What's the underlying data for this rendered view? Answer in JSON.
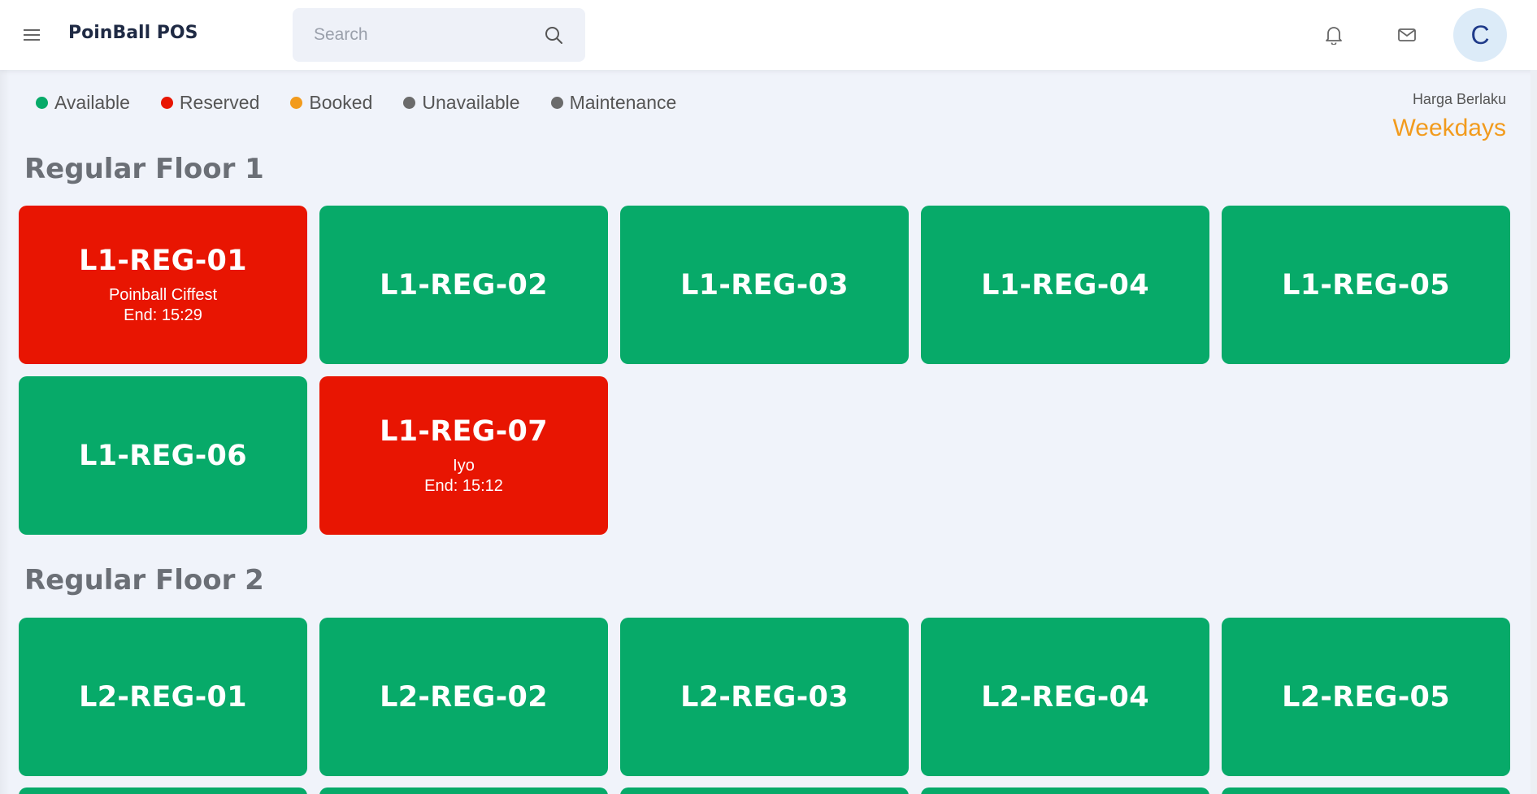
{
  "app": {
    "title": "PoinBall POS",
    "avatar_initial": "C"
  },
  "search": {
    "placeholder": "Search"
  },
  "icons": {
    "menu": "hamburger-menu-icon",
    "search": "search-icon",
    "bell": "bell-icon",
    "mail": "mail-icon"
  },
  "legend": [
    {
      "label": "Available",
      "color": "#07aa69"
    },
    {
      "label": "Reserved",
      "color": "#e81502"
    },
    {
      "label": "Booked",
      "color": "#f29b1d"
    },
    {
      "label": "Unavailable",
      "color": "#6b6b6b"
    },
    {
      "label": "Maintenance",
      "color": "#6b6b6b"
    }
  ],
  "pricing": {
    "label": "Harga Berlaku",
    "value": "Weekdays"
  },
  "floors": [
    {
      "title": "Regular Floor 1",
      "tables": [
        {
          "name": "L1-REG-01",
          "status": "reserved",
          "customer": "Poinball Ciffest",
          "end": "End: 15:29"
        },
        {
          "name": "L1-REG-02",
          "status": "available"
        },
        {
          "name": "L1-REG-03",
          "status": "available"
        },
        {
          "name": "L1-REG-04",
          "status": "available"
        },
        {
          "name": "L1-REG-05",
          "status": "available"
        },
        {
          "name": "L1-REG-06",
          "status": "available"
        },
        {
          "name": "L1-REG-07",
          "status": "reserved",
          "customer": "Iyo",
          "end": "End: 15:12"
        }
      ]
    },
    {
      "title": "Regular Floor 2",
      "tables": [
        {
          "name": "L2-REG-01",
          "status": "available"
        },
        {
          "name": "L2-REG-02",
          "status": "available"
        },
        {
          "name": "L2-REG-03",
          "status": "available"
        },
        {
          "name": "L2-REG-04",
          "status": "available"
        },
        {
          "name": "L2-REG-05",
          "status": "available"
        }
      ]
    }
  ]
}
